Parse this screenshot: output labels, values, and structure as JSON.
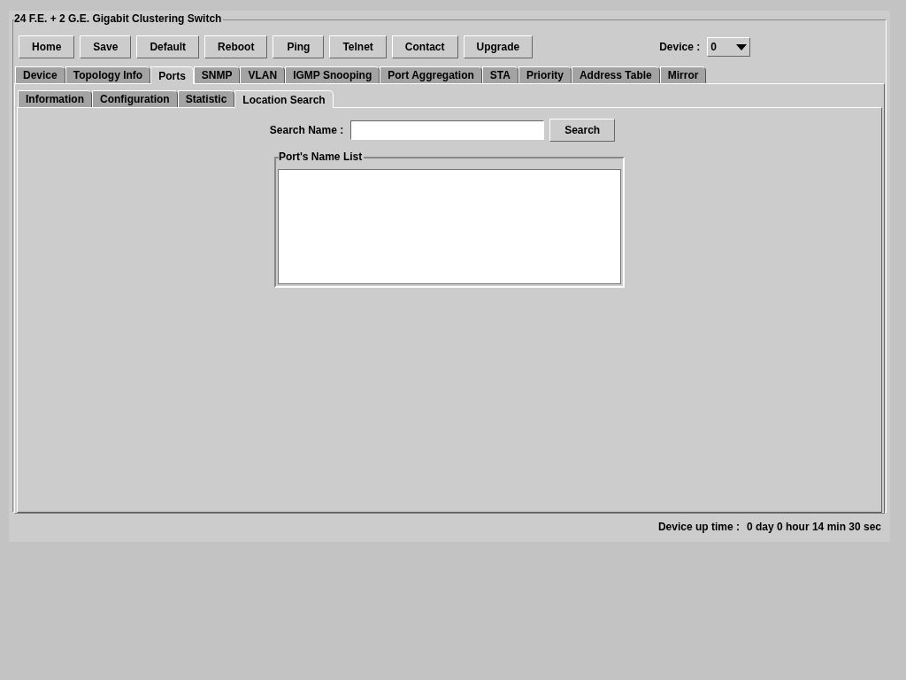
{
  "group_title": "24 F.E. + 2 G.E. Gigabit Clustering Switch",
  "buttons": [
    "Home",
    "Save",
    "Default",
    "Reboot",
    "Ping",
    "Telnet",
    "Contact",
    "Upgrade"
  ],
  "device": {
    "label": "Device :",
    "value": "0"
  },
  "tabs": [
    {
      "label": "Device",
      "selected": false
    },
    {
      "label": "Topology Info",
      "selected": false
    },
    {
      "label": "Ports",
      "selected": true
    },
    {
      "label": "SNMP",
      "selected": false
    },
    {
      "label": "VLAN",
      "selected": false
    },
    {
      "label": "IGMP Snooping",
      "selected": false
    },
    {
      "label": "Port Aggregation",
      "selected": false
    },
    {
      "label": "STA",
      "selected": false
    },
    {
      "label": "Priority",
      "selected": false
    },
    {
      "label": "Address Table",
      "selected": false
    },
    {
      "label": "Mirror",
      "selected": false
    }
  ],
  "subtabs": [
    {
      "label": "Information",
      "selected": false
    },
    {
      "label": "Configuration",
      "selected": false
    },
    {
      "label": "Statistic",
      "selected": false
    },
    {
      "label": "Location Search",
      "selected": true
    }
  ],
  "search": {
    "label": "Search Name :",
    "button": "Search"
  },
  "list_title": "Port's Name List",
  "status": {
    "label": "Device up time :",
    "value": "0 day 0 hour 14 min 30 sec"
  }
}
